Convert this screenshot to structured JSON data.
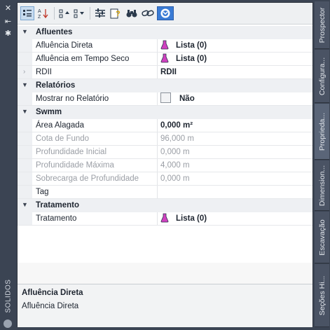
{
  "left_bar": {
    "vertical_title": "SOLIDOS"
  },
  "toolbar": {
    "buttons": [
      "categorized",
      "alphabetical",
      "collapse",
      "expand",
      "filter",
      "help",
      "binoculars",
      "link",
      "settings"
    ]
  },
  "grid": {
    "categories": {
      "afluentes": "Afluentes",
      "relatorios": "Relatórios",
      "swmm": "Swmm",
      "tratamento": "Tratamento"
    },
    "rows": {
      "afluencia_direta": {
        "name": "Afluência Direta",
        "value": "Lista (0)"
      },
      "afluencia_seco": {
        "name": "Afluência em Tempo Seco",
        "value": "Lista (0)"
      },
      "rdii": {
        "name": "RDII",
        "value": "RDII"
      },
      "mostrar": {
        "name": "Mostrar no Relatório",
        "value": "Não"
      },
      "area": {
        "name": "Área Alagada",
        "value": "0,000 m²"
      },
      "cota": {
        "name": "Cota de Fundo",
        "value": "96,000 m"
      },
      "prof_ini": {
        "name": "Profundidade Inicial",
        "value": "0,000 m"
      },
      "prof_max": {
        "name": "Profundidade Máxima",
        "value": "4,000 m"
      },
      "sobrecarga": {
        "name": "Sobrecarga de Profundidade",
        "value": "0,000 m"
      },
      "tag": {
        "name": "Tag",
        "value": ""
      },
      "tratamento": {
        "name": "Tratamento",
        "value": "Lista (0)"
      }
    }
  },
  "description": {
    "title": "Afluência Direta",
    "text": "Afluência Direta"
  },
  "right_tabs": [
    "Prospector",
    "Configura...",
    "Proprieda...",
    "Dimension...",
    "Escavação",
    "Seções Hi..."
  ],
  "colors": {
    "frame": "#3b4453",
    "flask": "#d040c0",
    "tab_active": "#5a6578"
  }
}
